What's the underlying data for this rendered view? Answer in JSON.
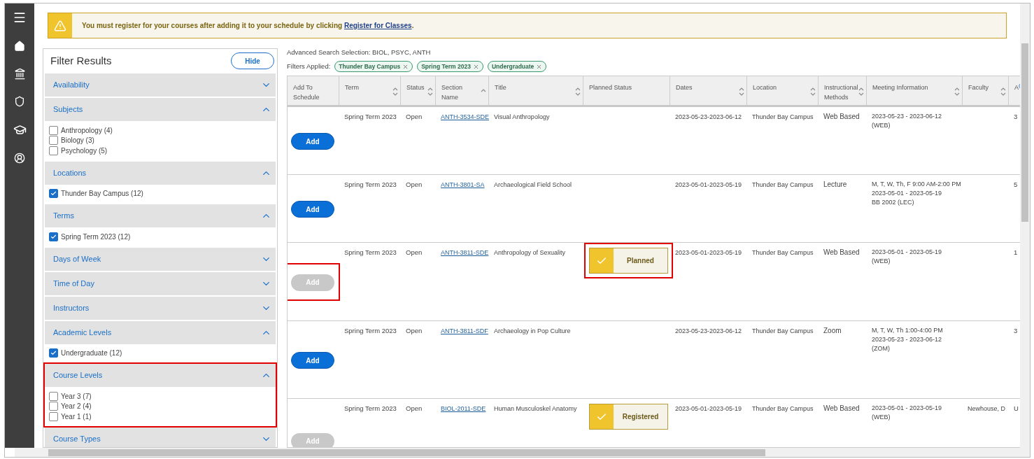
{
  "banner": {
    "text_before": "You must register for your courses after adding it to your schedule by clicking ",
    "link": "Register for Classes",
    "text_after": "."
  },
  "filter_panel": {
    "title": "Filter Results",
    "hide_button": "Hide",
    "groups": [
      {
        "label": "Availability",
        "expanded": false,
        "highlighted": false
      },
      {
        "label": "Subjects",
        "expanded": true,
        "highlighted": false,
        "options": [
          {
            "label": "Anthropology (4)",
            "checked": false
          },
          {
            "label": "Biology (3)",
            "checked": false
          },
          {
            "label": "Psychology (5)",
            "checked": false
          }
        ]
      },
      {
        "label": "Locations",
        "expanded": true,
        "highlighted": false,
        "options": [
          {
            "label": "Thunder Bay Campus (12)",
            "checked": true
          }
        ]
      },
      {
        "label": "Terms",
        "expanded": true,
        "highlighted": false,
        "options": [
          {
            "label": "Spring Term 2023 (12)",
            "checked": true
          }
        ]
      },
      {
        "label": "Days of Week",
        "expanded": false,
        "highlighted": false
      },
      {
        "label": "Time of Day",
        "expanded": false,
        "highlighted": false
      },
      {
        "label": "Instructors",
        "expanded": false,
        "highlighted": false
      },
      {
        "label": "Academic Levels",
        "expanded": true,
        "highlighted": false,
        "options": [
          {
            "label": "Undergraduate (12)",
            "checked": true
          }
        ]
      },
      {
        "label": "Course Levels",
        "expanded": true,
        "highlighted": true,
        "options": [
          {
            "label": "Year 3 (7)",
            "checked": false
          },
          {
            "label": "Year 2 (4)",
            "checked": false
          },
          {
            "label": "Year 1 (1)",
            "checked": false
          }
        ]
      },
      {
        "label": "Course Types",
        "expanded": false,
        "highlighted": false
      }
    ]
  },
  "results": {
    "search_selection": "Advanced Search Selection: BIOL, PSYC, ANTH",
    "filters_label": "Filters Applied:",
    "filter_chips": [
      "Thunder Bay Campus",
      "Spring Term 2023",
      "Undergraduate"
    ],
    "table": {
      "columns": [
        {
          "label": "Add To Schedule",
          "kind": "plain"
        },
        {
          "label": "Term",
          "kind": "sortable"
        },
        {
          "label": "Status",
          "kind": "sortable"
        },
        {
          "label": "Section Name",
          "kind": "ascending"
        },
        {
          "label": "Title",
          "kind": "sortable"
        },
        {
          "label": "Planned Status",
          "kind": "plain"
        },
        {
          "label": "Dates",
          "kind": "sortable"
        },
        {
          "label": "Location",
          "kind": "sortable"
        },
        {
          "label": "Instructional Methods",
          "kind": "sortable"
        },
        {
          "label": "Meeting Information",
          "kind": "sortable"
        },
        {
          "label": "Faculty",
          "kind": "sortable"
        },
        {
          "label": "A",
          "kind": "info"
        }
      ],
      "rows": [
        {
          "add_button": {
            "label": "Add",
            "disabled": false,
            "highlighted": false
          },
          "term": "Spring Term 2023",
          "status": "Open",
          "section": "ANTH-3534-SDE",
          "title": "Visual Anthropology",
          "dates": "2023-05-23-2023-06-12",
          "location": "Thunder Bay Campus",
          "method": "Web Based",
          "meeting": [
            "2023-05-23 - 2023-06-12",
            "(WEB)"
          ],
          "column_11": "3"
        },
        {
          "add_button": {
            "label": "Add",
            "disabled": false,
            "highlighted": false
          },
          "term": "Spring Term 2023",
          "status": "Open",
          "section": "ANTH-3801-SA",
          "title": "Archaeological Field School",
          "dates": "2023-05-01-2023-05-19",
          "location": "Thunder Bay Campus",
          "method": "Lecture",
          "meeting": [
            "M, T, W, Th, F 9:00 AM-2:00 PM",
            "2023-05-01 - 2023-05-19",
            "BB 2002 (LEC)"
          ],
          "column_11": "5"
        },
        {
          "add_button": {
            "label": "Add",
            "disabled": true,
            "highlighted": true
          },
          "term": "Spring Term 2023",
          "status": "Open",
          "section": "ANTH-3811-SDE",
          "title": "Anthropology of Sexuality",
          "planned_status": {
            "label": "Planned",
            "highlighted": true
          },
          "dates": "2023-05-01-2023-05-19",
          "location": "Thunder Bay Campus",
          "method": "Web Based",
          "meeting": [
            "2023-05-01 - 2023-05-19",
            "(WEB)"
          ],
          "column_11": "1"
        },
        {
          "add_button": {
            "label": "Add",
            "disabled": false,
            "highlighted": false
          },
          "term": "Spring Term 2023",
          "status": "Open",
          "section": "ANTH-3811-SDF",
          "title": "Archaeology in Pop Culture",
          "dates": "2023-05-23-2023-06-12",
          "location": "Thunder Bay Campus",
          "method": "Zoom",
          "meeting": [
            "M, T, W, Th 1:00-4:00 PM",
            "2023-05-23 - 2023-06-12",
            "(ZOM)"
          ],
          "column_11": "3"
        },
        {
          "add_button": {
            "label": "Add",
            "disabled": true,
            "highlighted": false
          },
          "term": "Spring Term 2023",
          "status": "Open",
          "section": "BIOL-2011-SDE",
          "title": "Human Musculoskel Anatomy",
          "planned_status": {
            "label": "Registered",
            "highlighted": false
          },
          "dates": "2023-05-01-2023-05-19",
          "location": "Thunder Bay Campus",
          "method": "Web Based",
          "meeting": [
            "2023-05-01 - 2023-05-19",
            "(WEB)"
          ],
          "faculty": "Newhouse, D",
          "column_11": "U"
        }
      ]
    }
  }
}
